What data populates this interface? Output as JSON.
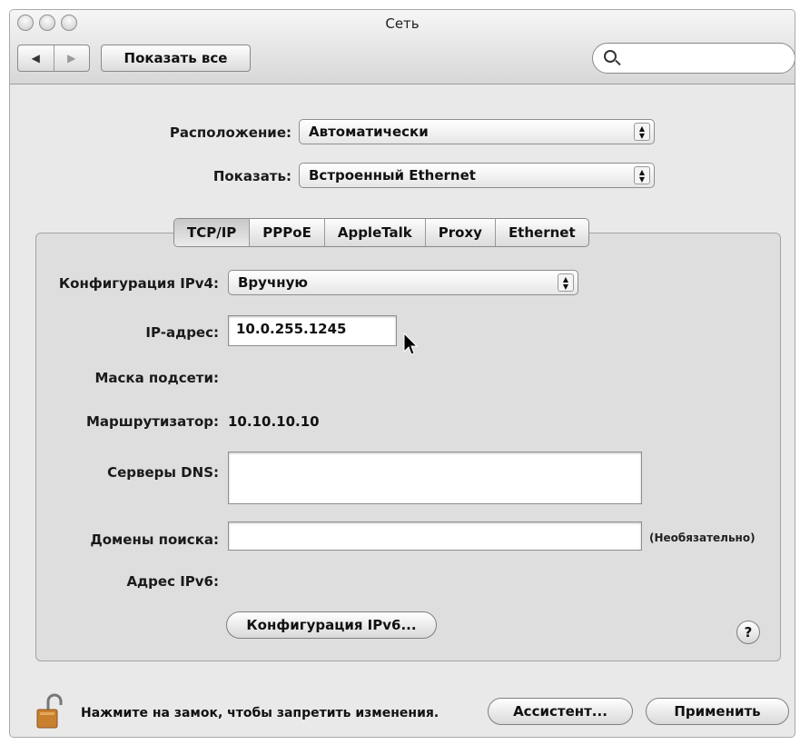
{
  "window": {
    "title": "Сеть"
  },
  "toolbar": {
    "back_icon": "◀",
    "forward_icon": "▶",
    "show_all_label": "Показать все",
    "search": {
      "value": "",
      "placeholder": ""
    }
  },
  "location": {
    "label": "Расположение:",
    "value": "Автоматически"
  },
  "show": {
    "label": "Показать:",
    "value": "Встроенный Ethernet"
  },
  "tabs": [
    "TCP/IP",
    "PPPoE",
    "AppleTalk",
    "Proxy",
    "Ethernet"
  ],
  "selected_tab": "TCP/IP",
  "form": {
    "ipv4_config": {
      "label": "Конфигурация IPv4:",
      "value": "Вручную"
    },
    "ip_address": {
      "label": "IP-адрес:",
      "value": "10.0.255.1245"
    },
    "subnet_mask": {
      "label": "Маска подсети:",
      "value": ""
    },
    "router": {
      "label": "Маршрутизатор:",
      "value": "10.10.10.10"
    },
    "dns_servers": {
      "label": "Серверы DNS:",
      "value": ""
    },
    "search_domains": {
      "label": "Домены поиска:",
      "value": "",
      "hint": "(Необязательно)"
    },
    "ipv6_address": {
      "label": "Адрес IPv6:",
      "value": ""
    },
    "configure_ipv6_label": "Конфигурация IPv6...",
    "help_label": "?"
  },
  "footer": {
    "lock_text": "Нажмите на замок, чтобы запретить изменения.",
    "assist_label": "Ассистент...",
    "apply_label": "Применить"
  }
}
